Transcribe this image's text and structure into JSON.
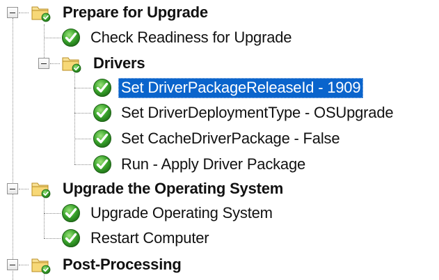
{
  "tree": {
    "groups": [
      {
        "label": "Prepare for Upgrade",
        "icon": "folder-check-icon",
        "expanded": true,
        "items": [
          {
            "label": "Check Readiness for Upgrade",
            "icon": "green-check-icon"
          }
        ],
        "subgroup": {
          "label": "Drivers",
          "icon": "folder-check-icon",
          "expanded": true,
          "items": [
            {
              "label": "Set DriverPackageReleaseId - 1909",
              "icon": "green-check-icon",
              "selected": true
            },
            {
              "label": "Set DriverDeploymentType - OSUpgrade",
              "icon": "green-check-icon"
            },
            {
              "label": "Set CacheDriverPackage - False",
              "icon": "green-check-icon"
            },
            {
              "label": "Run - Apply Driver Package",
              "icon": "green-check-icon"
            }
          ]
        }
      },
      {
        "label": "Upgrade the Operating System",
        "icon": "folder-check-icon",
        "expanded": true,
        "items": [
          {
            "label": "Upgrade Operating System",
            "icon": "green-check-icon"
          },
          {
            "label": "Restart Computer",
            "icon": "green-check-icon"
          }
        ]
      },
      {
        "label": "Post-Processing",
        "icon": "folder-check-icon",
        "expanded": true,
        "items": []
      }
    ]
  },
  "colors": {
    "selection": "#0a64cc",
    "check_green": "#3aa42c",
    "folder_yellow": "#f2cf63"
  }
}
